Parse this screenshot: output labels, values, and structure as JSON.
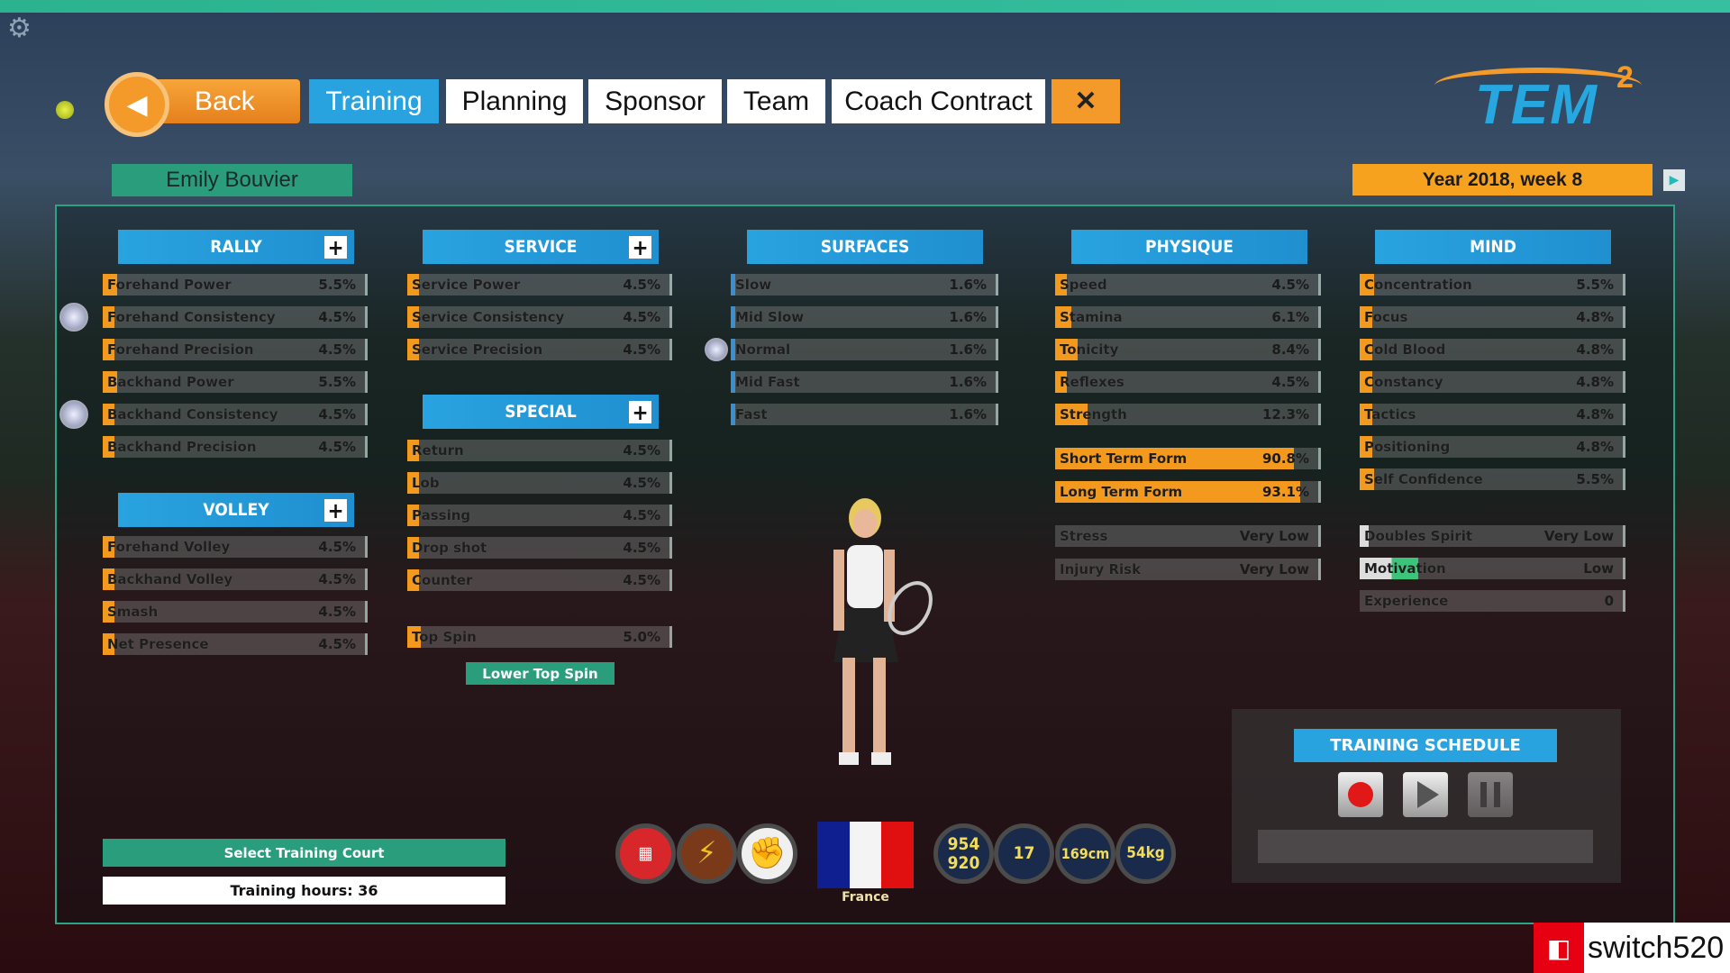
{
  "nav": {
    "back": "Back",
    "tabs": [
      "Training",
      "Planning",
      "Sponsor",
      "Team",
      "Coach Contract"
    ],
    "active": "Training",
    "close": "✕"
  },
  "logo": {
    "text": "TEM",
    "sup": "2"
  },
  "player": {
    "name": "Emily Bouvier",
    "country": "France",
    "stats": [
      "954\n920",
      "17",
      "169cm",
      "54kg"
    ]
  },
  "date": "Year 2018, week 8",
  "sections": {
    "rally": {
      "title": "RALLY",
      "rows": [
        [
          "Forehand Power",
          "5.5%"
        ],
        [
          "Forehand Consistency",
          "4.5%"
        ],
        [
          "Forehand Precision",
          "4.5%"
        ],
        [
          "Backhand Power",
          "5.5%"
        ],
        [
          "Backhand Consistency",
          "4.5%"
        ],
        [
          "Backhand Precision",
          "4.5%"
        ]
      ]
    },
    "volley": {
      "title": "VOLLEY",
      "rows": [
        [
          "Forehand Volley",
          "4.5%"
        ],
        [
          "Backhand Volley",
          "4.5%"
        ],
        [
          "Smash",
          "4.5%"
        ],
        [
          "Net Presence",
          "4.5%"
        ]
      ]
    },
    "service": {
      "title": "SERVICE",
      "rows": [
        [
          "Service Power",
          "4.5%"
        ],
        [
          "Service Consistency",
          "4.5%"
        ],
        [
          "Service Precision",
          "4.5%"
        ]
      ]
    },
    "special": {
      "title": "SPECIAL",
      "rows": [
        [
          "Return",
          "4.5%"
        ],
        [
          "Lob",
          "4.5%"
        ],
        [
          "Passing",
          "4.5%"
        ],
        [
          "Drop shot",
          "4.5%"
        ],
        [
          "Counter",
          "4.5%"
        ]
      ]
    },
    "topspin": {
      "rows": [
        [
          "Top Spin",
          "5.0%"
        ]
      ],
      "button": "Lower Top Spin"
    },
    "surfaces": {
      "title": "SURFACES",
      "rows": [
        [
          "Slow",
          "1.6%"
        ],
        [
          "Mid Slow",
          "1.6%"
        ],
        [
          "Normal",
          "1.6%"
        ],
        [
          "Mid Fast",
          "1.6%"
        ],
        [
          "Fast",
          "1.6%"
        ]
      ]
    },
    "physique": {
      "title": "PHYSIQUE",
      "rows": [
        [
          "Speed",
          "4.5%"
        ],
        [
          "Stamina",
          "6.1%"
        ],
        [
          "Tonicity",
          "8.4%"
        ],
        [
          "Reflexes",
          "4.5%"
        ],
        [
          "Strength",
          "12.3%"
        ]
      ]
    },
    "form": {
      "rows": [
        [
          "Short Term Form",
          "90.8%"
        ],
        [
          "Long Term Form",
          "93.1%"
        ]
      ]
    },
    "condition": {
      "rows": [
        [
          "Stress",
          "Very Low"
        ],
        [
          "Injury Risk",
          "Very Low"
        ]
      ]
    },
    "mind": {
      "title": "MIND",
      "rows": [
        [
          "Concentration",
          "5.5%"
        ],
        [
          "Focus",
          "4.8%"
        ],
        [
          "Cold Blood",
          "4.8%"
        ],
        [
          "Constancy",
          "4.8%"
        ],
        [
          "Tactics",
          "4.8%"
        ],
        [
          "Positioning",
          "4.8%"
        ],
        [
          "Self Confidence",
          "5.5%"
        ]
      ]
    },
    "mental": {
      "rows": [
        [
          "Doubles Spirit",
          "Very Low"
        ],
        [
          "Motivation",
          "Low"
        ],
        [
          "Experience",
          "0"
        ]
      ]
    }
  },
  "training": {
    "court_button": "Select Training Court",
    "hours": "Training hours: 36",
    "schedule_title": "TRAINING SCHEDULE"
  },
  "watermark": "switch520",
  "colors": {
    "accent_blue": "#29a3e0",
    "orange": "#f39a1e",
    "green": "#2a9e7c"
  }
}
